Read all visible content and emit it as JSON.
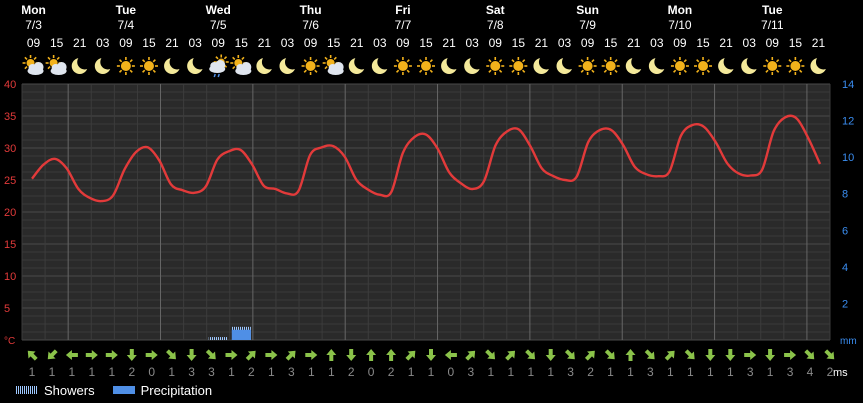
{
  "days": [
    {
      "name": "Mon",
      "date": "7/3"
    },
    {
      "name": "Tue",
      "date": "7/4"
    },
    {
      "name": "Wed",
      "date": "7/5"
    },
    {
      "name": "Thu",
      "date": "7/6"
    },
    {
      "name": "Fri",
      "date": "7/7"
    },
    {
      "name": "Sat",
      "date": "7/8"
    },
    {
      "name": "Sun",
      "date": "7/9"
    },
    {
      "name": "Mon",
      "date": "7/10"
    },
    {
      "name": "Tue",
      "date": "7/11"
    }
  ],
  "hours": [
    "09",
    "15",
    "21",
    "03",
    "09",
    "15",
    "21",
    "03",
    "09",
    "15",
    "21",
    "03",
    "09",
    "15",
    "21",
    "03",
    "09",
    "15",
    "21",
    "03",
    "09",
    "15",
    "21",
    "03",
    "09",
    "15",
    "21",
    "03",
    "09",
    "15",
    "21",
    "03",
    "09",
    "15",
    "21",
    "03",
    "09",
    "15",
    "21",
    "03",
    "09",
    "15",
    "21",
    "03",
    "09",
    "15",
    "21",
    "03",
    "09",
    "15",
    "21",
    "03",
    "09",
    "15",
    "21",
    "03",
    "09",
    "15",
    "21",
    "03",
    "09",
    "15",
    "21"
  ],
  "icons": [
    "partly-cloudy-icon",
    "partly-cloudy-icon",
    "moon-icon",
    "moon-icon",
    "sun-icon",
    "sun-icon",
    "moon-icon",
    "moon-icon",
    "rain-shower-icon",
    "partly-cloudy-icon",
    "moon-icon",
    "moon-icon",
    "sun-icon",
    "partly-cloudy-icon",
    "moon-icon",
    "moon-icon",
    "sun-icon",
    "sun-icon",
    "moon-icon",
    "moon-icon",
    "sun-icon",
    "sun-icon",
    "moon-icon",
    "moon-icon",
    "sun-icon",
    "sun-icon",
    "moon-icon",
    "moon-icon",
    "sun-icon",
    "sun-icon",
    "moon-icon",
    "moon-icon",
    "sun-icon",
    "sun-icon",
    "moon-icon"
  ],
  "chart_data": {
    "type": "line",
    "title": "",
    "left_axis": {
      "unit": "°C",
      "ticks": [
        40,
        35,
        30,
        25,
        20,
        15,
        10,
        5
      ],
      "range": [
        0,
        40
      ]
    },
    "right_axis": {
      "unit": "ms",
      "ticks": [
        14,
        12,
        10,
        8,
        6,
        4,
        2
      ],
      "range": [
        0,
        14
      ]
    },
    "right_axis_bottom_label": "mm",
    "temperature": [
      25.2,
      27.4,
      28.3,
      26.8,
      23.6,
      22.2,
      21.7,
      22.6,
      26.7,
      29.4,
      30.1,
      28.0,
      24.3,
      23.4,
      23.0,
      24.0,
      28.2,
      29.5,
      29.7,
      27.4,
      24.1,
      23.6,
      22.9,
      23.3,
      28.9,
      30.1,
      30.3,
      28.6,
      25.0,
      23.5,
      22.7,
      23.1,
      29.2,
      31.7,
      32.1,
      29.9,
      26.2,
      24.5,
      23.6,
      24.8,
      30.4,
      32.6,
      32.9,
      30.3,
      26.8,
      25.6,
      25.0,
      25.5,
      30.9,
      32.8,
      32.8,
      30.5,
      27.1,
      25.9,
      25.6,
      26.3,
      31.9,
      33.6,
      33.3,
      30.9,
      27.6,
      26.0,
      25.7,
      26.6,
      32.6,
      34.8,
      34.6,
      31.5,
      27.5
    ],
    "precipitation": [
      {
        "slot": 8,
        "showers": 0.2,
        "precipitation": 0
      },
      {
        "slot": 9,
        "showers": 0.9,
        "precipitation": 0.7
      }
    ],
    "legend": [
      "Showers",
      "Precipitation"
    ]
  },
  "wind_directions": [
    "nw",
    "sw",
    "w",
    "e",
    "e",
    "s",
    "e",
    "se",
    "s",
    "se",
    "e",
    "ne",
    "e",
    "ne",
    "e",
    "n",
    "s",
    "n",
    "n",
    "ne",
    "s",
    "w",
    "ne",
    "se",
    "ne",
    "se",
    "s",
    "se",
    "ne",
    "se",
    "n",
    "se",
    "ne",
    "se",
    "s",
    "s",
    "e",
    "s",
    "e",
    "se",
    "se"
  ],
  "wind_speeds": [
    "1",
    "1",
    "1",
    "1",
    "1",
    "2",
    "0",
    "1",
    "3",
    "3",
    "1",
    "2",
    "1",
    "3",
    "1",
    "1",
    "2",
    "0",
    "2",
    "1",
    "1",
    "0",
    "3",
    "1",
    "1",
    "1",
    "1",
    "3",
    "2",
    "1",
    "1",
    "3",
    "1",
    "1",
    "1",
    "1",
    "3",
    "1",
    "3",
    "4",
    "2"
  ],
  "legend": {
    "showers": "Showers",
    "precipitation": "Precipitation"
  }
}
